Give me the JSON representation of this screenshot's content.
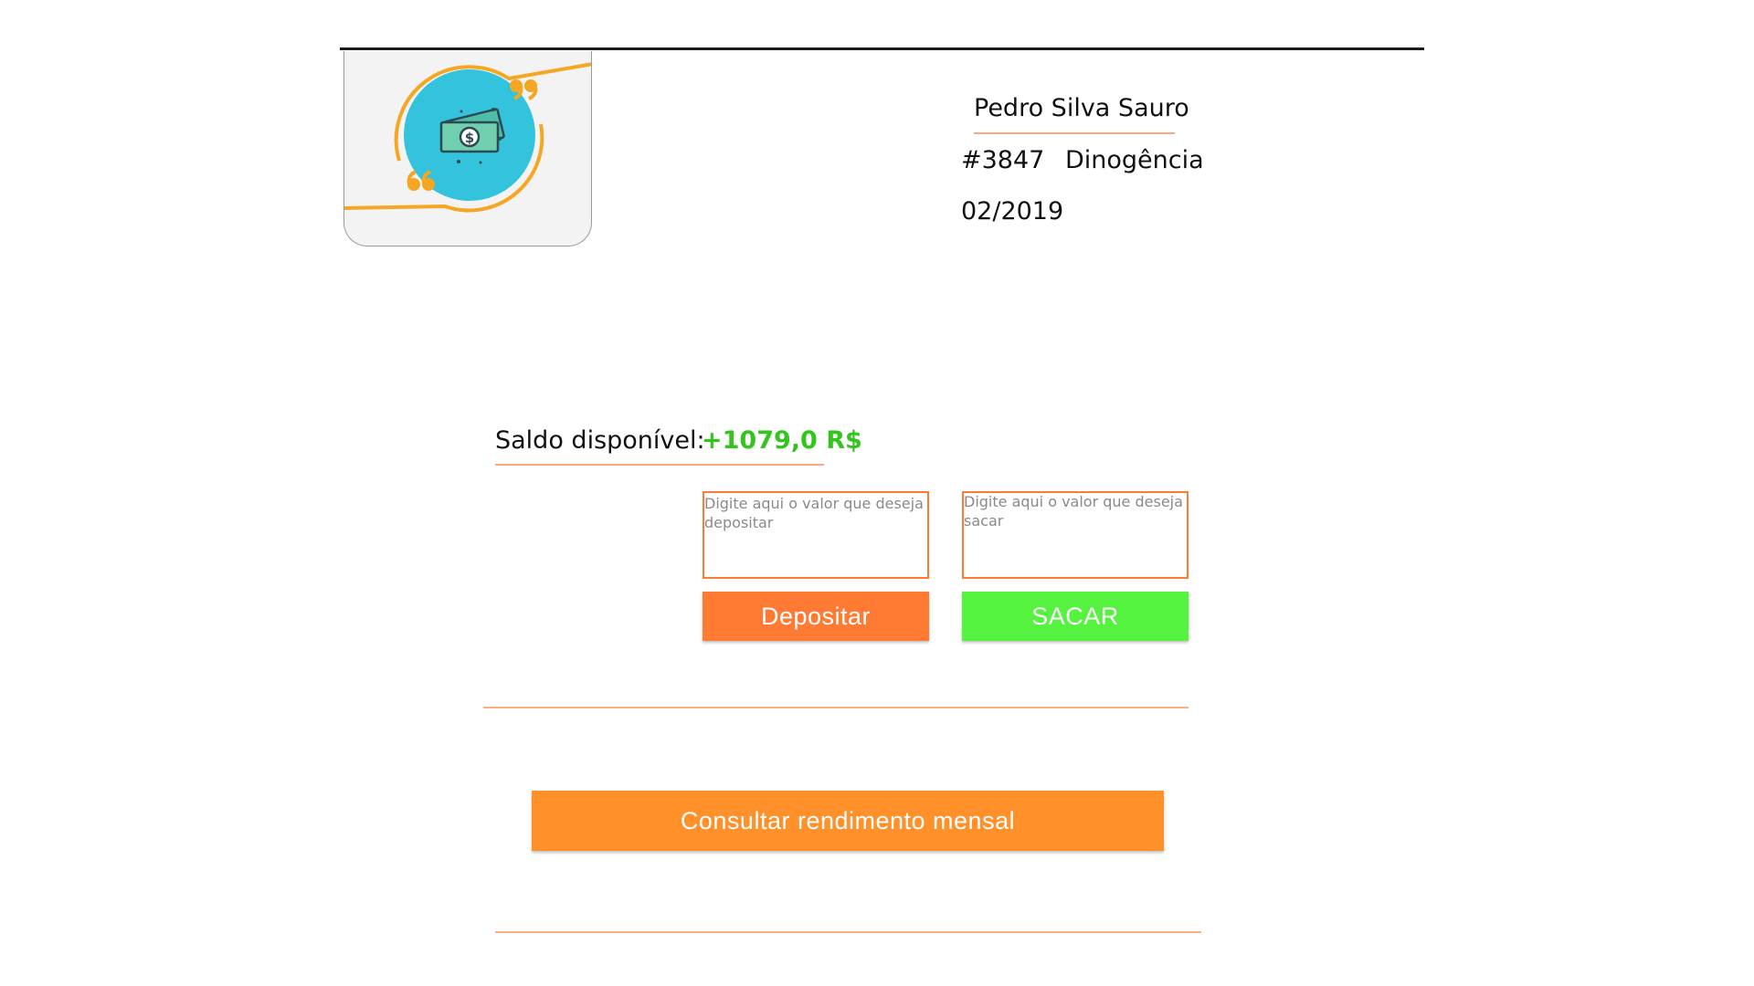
{
  "client": {
    "name": "Pedro Silva Sauro",
    "account_number": "#3847",
    "agency": "Dinogência",
    "date": "02/2019"
  },
  "balance": {
    "label": "Saldo disponível:",
    "value": "+1079,0 R$",
    "value_color": "#33c51e"
  },
  "deposit": {
    "placeholder": "Digite aqui o valor que deseja depositar",
    "button_label": "Depositar",
    "button_color": "#ff7a33"
  },
  "withdraw": {
    "placeholder": "Digite aqui o valor que deseja sacar",
    "button_label": "SACAR",
    "button_color": "#55f33f"
  },
  "monthly_yield": {
    "button_label": "Consultar rendimento mensal",
    "button_color": "#ff902a"
  },
  "logo": {
    "icon": "money-icon",
    "circle_color": "#33c3dc",
    "accent_color": "#f5a623"
  }
}
